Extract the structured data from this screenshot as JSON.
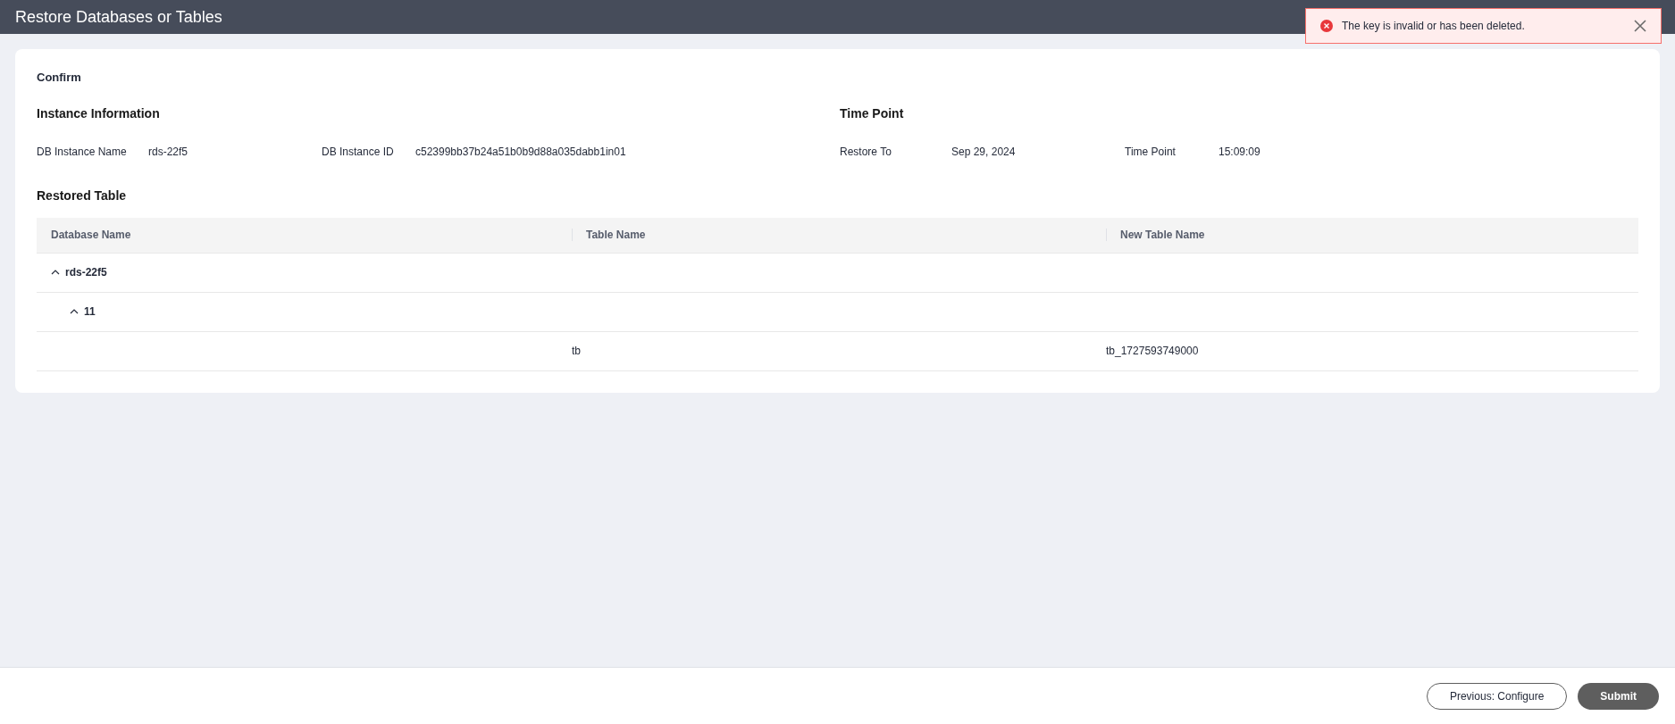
{
  "header": {
    "title": "Restore Databases or Tables"
  },
  "toast": {
    "kind": "error",
    "message": "The key is invalid or has been deleted."
  },
  "step_title": "Confirm",
  "instance_information": {
    "title": "Instance Information",
    "fields": [
      {
        "label": "DB Instance Name",
        "value": "rds-22f5"
      },
      {
        "label": "DB Instance ID",
        "value": "c52399bb37b24a51b0b9d88a035dabb1in01"
      }
    ]
  },
  "time_point": {
    "title": "Time Point",
    "fields": [
      {
        "label": "Restore To",
        "value": "Sep 29, 2024"
      },
      {
        "label": "Time Point",
        "value": "15:09:09"
      }
    ]
  },
  "restored_table": {
    "title": "Restored Table",
    "columns": [
      "Database Name",
      "Table Name",
      "New Table Name"
    ],
    "rows": [
      {
        "name": "rds-22f5",
        "expanded": true,
        "children": [
          {
            "name": "11",
            "expanded": true,
            "children": [
              {
                "table_name": "tb",
                "new_table_name": "tb_1727593749000"
              }
            ]
          }
        ]
      }
    ]
  },
  "footer": {
    "buttons": [
      {
        "label": "Previous: Configure",
        "kind": "secondary"
      },
      {
        "label": "Submit",
        "kind": "primary"
      }
    ]
  }
}
